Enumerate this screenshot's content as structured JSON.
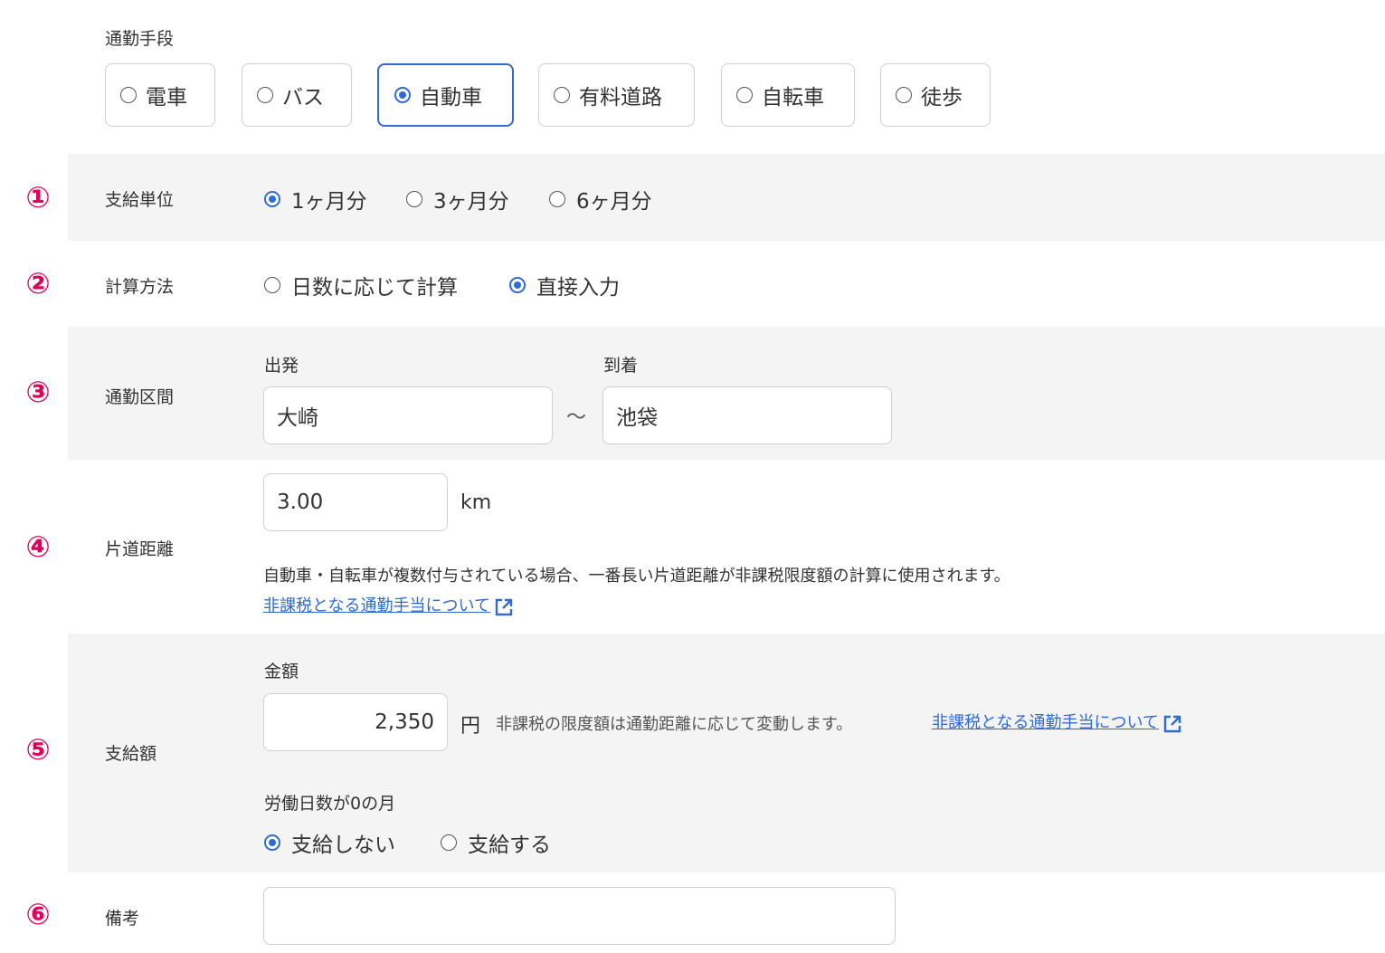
{
  "commute_mode": {
    "label": "通勤手段",
    "options": [
      "電車",
      "バス",
      "自動車",
      "有料道路",
      "自転車",
      "徒歩"
    ],
    "selected": "自動車"
  },
  "markers": [
    "①",
    "②",
    "③",
    "④",
    "⑤",
    "⑥"
  ],
  "payment_unit": {
    "label": "支給単位",
    "options": [
      "1ヶ月分",
      "3ヶ月分",
      "6ヶ月分"
    ],
    "selected": "1ヶ月分"
  },
  "calc_method": {
    "label": "計算方法",
    "options": [
      "日数に応じて計算",
      "直接入力"
    ],
    "selected": "直接入力"
  },
  "commute_section": {
    "label": "通勤区間",
    "departure_label": "出発",
    "departure_value": "大崎",
    "separator": "〜",
    "arrival_label": "到着",
    "arrival_value": "池袋"
  },
  "one_way_distance": {
    "label": "片道距離",
    "value": "3.00",
    "unit": "km",
    "note": "自動車・自転車が複数付与されている場合、一番長い片道距離が非課税限度額の計算に使用されます。",
    "link": "非課税となる通勤手当について"
  },
  "payment_amount": {
    "label": "支給額",
    "amount_label": "金額",
    "amount_value": "2,350",
    "currency": "円",
    "note": "非課税の限度額は通勤距離に応じて変動します。",
    "link": "非課税となる通勤手当について",
    "zero_days_label": "労働日数が0の月",
    "zero_days_options": [
      "支給しない",
      "支給する"
    ],
    "zero_days_selected": "支給しない"
  },
  "remarks": {
    "label": "備考",
    "value": ""
  },
  "colors": {
    "accent": "#2f6bd6",
    "marker": "#e0005a",
    "band": "#f5f4f5"
  }
}
